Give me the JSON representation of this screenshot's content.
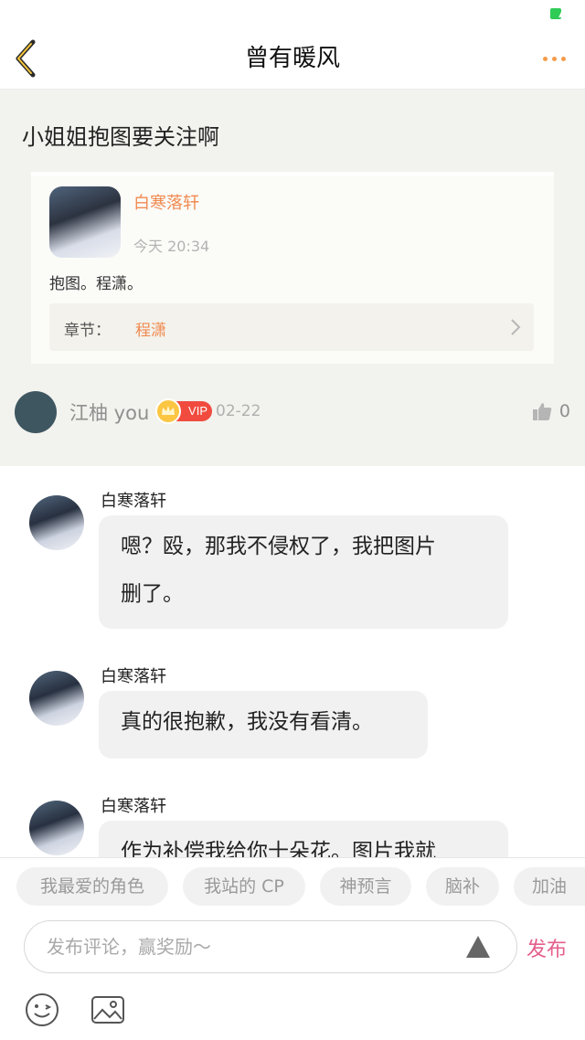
{
  "header": {
    "title": "曾有暖风"
  },
  "post": {
    "text": "小姐姐抱图要关注啊",
    "embed": {
      "name": "白寒落轩",
      "time": "今天 20:34",
      "body": "抱图。程潇。",
      "chapter_label": "章节：",
      "chapter_value": "程潇"
    },
    "author": {
      "name": "江柚 you",
      "badge": "VIP",
      "date": "02-22",
      "likes": "0"
    }
  },
  "replies": [
    {
      "name": "白寒落轩",
      "lines": [
        "嗯？殴，那我不侵权了，我把图片",
        "删了。"
      ]
    },
    {
      "name": "白寒落轩",
      "lines": [
        "真的很抱歉，我没有看清。"
      ]
    },
    {
      "name": "白寒落轩",
      "lines": [
        "作为补偿我给你十朵花。图片我就"
      ]
    }
  ],
  "chips": [
    "我最爱的角色",
    "我站的 CP",
    "神预言",
    "脑补",
    "加油"
  ],
  "comment": {
    "placeholder": "发布评论，赢奖励～",
    "publish_label": "发布"
  },
  "colors": {
    "accent_orange": "#f08a50",
    "publish_pink": "#e45e8c",
    "vip_red": "#f04b3e"
  }
}
